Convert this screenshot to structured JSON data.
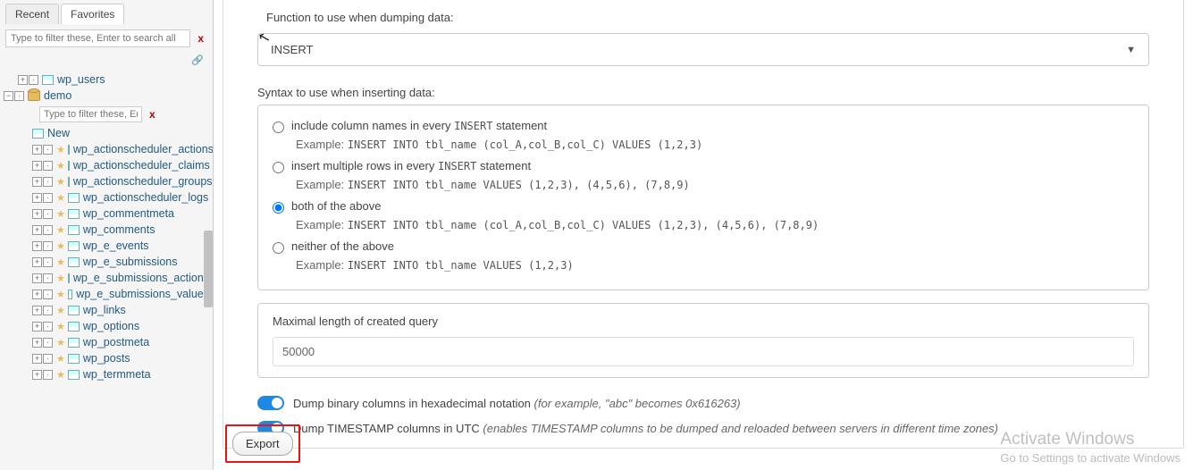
{
  "sidebar": {
    "tab_recent": "Recent",
    "tab_favorites": "Favorites",
    "filter_placeholder": "Type to filter these, Enter to search all",
    "sub_filter_placeholder": "Type to filter these, Enter",
    "clear": "x",
    "link_glyph": "🔗",
    "new_label": "New",
    "db_wp_users": "wp_users",
    "db_demo": "demo",
    "tables": [
      "wp_actionscheduler_actions",
      "wp_actionscheduler_claims",
      "wp_actionscheduler_groups",
      "wp_actionscheduler_logs",
      "wp_commentmeta",
      "wp_comments",
      "wp_e_events",
      "wp_e_submissions",
      "wp_e_submissions_actions",
      "wp_e_submissions_values",
      "wp_links",
      "wp_options",
      "wp_postmeta",
      "wp_posts",
      "wp_termmeta"
    ]
  },
  "main": {
    "dump_function_label": "Function to use when dumping data:",
    "dump_function_value": "INSERT",
    "syntax_label": "Syntax to use when inserting data:",
    "opt1": {
      "label_pre": "include column names in every ",
      "label_code": "INSERT",
      "label_post": " statement",
      "example_label": "Example: ",
      "example_code": "INSERT INTO tbl_name (col_A,col_B,col_C) VALUES (1,2,3)"
    },
    "opt2": {
      "label_pre": "insert multiple rows in every ",
      "label_code": "INSERT",
      "label_post": " statement",
      "example_label": "Example: ",
      "example_code": "INSERT INTO tbl_name VALUES (1,2,3), (4,5,6), (7,8,9)"
    },
    "opt3": {
      "label": "both of the above",
      "example_label": "Example: ",
      "example_code": "INSERT INTO tbl_name (col_A,col_B,col_C) VALUES (1,2,3), (4,5,6), (7,8,9)"
    },
    "opt4": {
      "label": "neither of the above",
      "example_label": "Example: ",
      "example_code": "INSERT INTO tbl_name VALUES (1,2,3)"
    },
    "maxlen_label": "Maximal length of created query",
    "maxlen_value": "50000",
    "toggle1_text": "Dump binary columns in hexadecimal notation ",
    "toggle1_note": "(for example, \"abc\" becomes 0x616263)",
    "toggle2_text": "Dump TIMESTAMP columns in UTC ",
    "toggle2_note": "(enables TIMESTAMP columns to be dumped and reloaded between servers in different time zones)",
    "export_btn": "Export"
  },
  "watermark": {
    "line1": "Activate Windows",
    "line2": "Go to Settings to activate Windows"
  }
}
